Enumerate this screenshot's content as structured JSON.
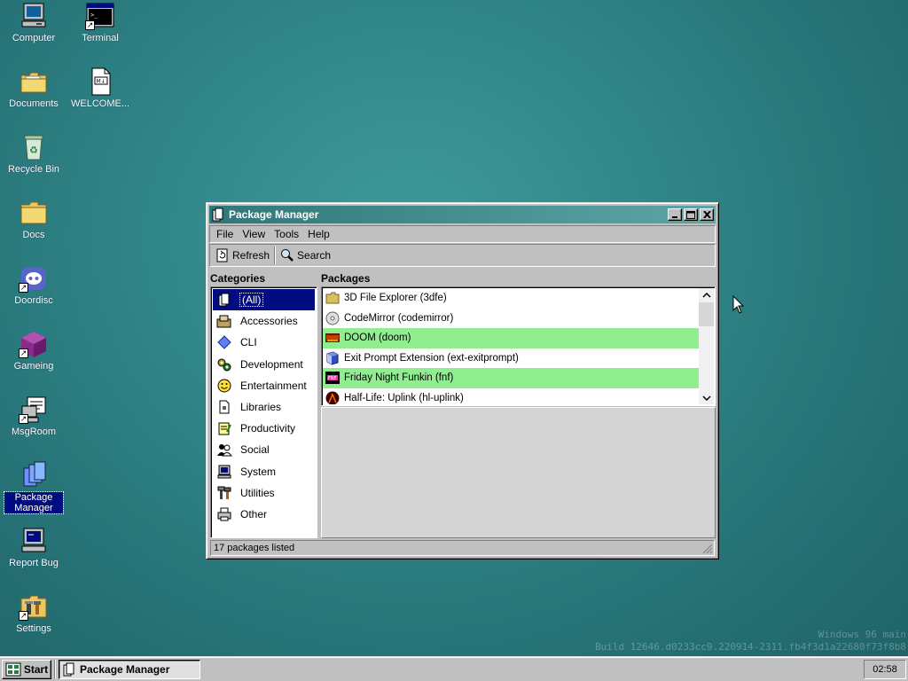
{
  "desktop": {
    "icons": [
      {
        "label": "Computer"
      },
      {
        "label": "Terminal"
      },
      {
        "label": "Documents"
      },
      {
        "label": "WELCOME..."
      },
      {
        "label": "Recycle Bin"
      },
      {
        "label": "Docs"
      },
      {
        "label": "Doordisc"
      },
      {
        "label": "Gameing"
      },
      {
        "label": "MsgRoom"
      },
      {
        "label": "Package Manager"
      },
      {
        "label": "Report Bug"
      },
      {
        "label": "Settings"
      }
    ],
    "selected_icon": "Package Manager"
  },
  "window": {
    "title": "Package Manager",
    "menu": [
      "File",
      "View",
      "Tools",
      "Help"
    ],
    "toolbar": {
      "refresh_label": "Refresh",
      "search_label": "Search"
    },
    "categories_header": "Categories",
    "packages_header": "Packages",
    "categories": [
      {
        "label": "(All)",
        "icon": "document-icon",
        "selected": true
      },
      {
        "label": "Accessories",
        "icon": "accessories-icon"
      },
      {
        "label": "CLI",
        "icon": "diamond-icon"
      },
      {
        "label": "Development",
        "icon": "gears-icon"
      },
      {
        "label": "Entertainment",
        "icon": "smiley-icon"
      },
      {
        "label": "Libraries",
        "icon": "library-icon"
      },
      {
        "label": "Productivity",
        "icon": "notepad-icon"
      },
      {
        "label": "Social",
        "icon": "people-icon"
      },
      {
        "label": "System",
        "icon": "computer-icon"
      },
      {
        "label": "Utilities",
        "icon": "tools-icon"
      },
      {
        "label": "Other",
        "icon": "printer-icon"
      }
    ],
    "packages": [
      {
        "label": "3D File Explorer (3dfe)",
        "icon": "folder-icon",
        "highlight": false
      },
      {
        "label": "CodeMirror (codemirror)",
        "icon": "cd-icon",
        "highlight": false
      },
      {
        "label": "DOOM (doom)",
        "icon": "doom-icon",
        "highlight": true
      },
      {
        "label": "Exit Prompt Extension (ext-exitprompt)",
        "icon": "cube-icon",
        "highlight": false
      },
      {
        "label": "Friday Night Funkin (fnf)",
        "icon": "fnf-icon",
        "highlight": true
      },
      {
        "label": "Half-Life: Uplink (hl-uplink)",
        "icon": "halflife-icon",
        "highlight": false
      }
    ],
    "status": "17 packages listed"
  },
  "taskbar": {
    "start_label": "Start",
    "task_label": "Package Manager",
    "clock": "02:58"
  },
  "watermark": {
    "line1": "Windows 96 main",
    "line2": "Build 12646.d0233cc9.220914-2311.fb4f3d1a22680f73f8b8"
  },
  "colors": {
    "desktop": "#2f8486",
    "titlebar_start": "#2f7779",
    "titlebar_end": "#5da5a6",
    "selection": "#000c80",
    "highlight_row": "#90ee90"
  }
}
